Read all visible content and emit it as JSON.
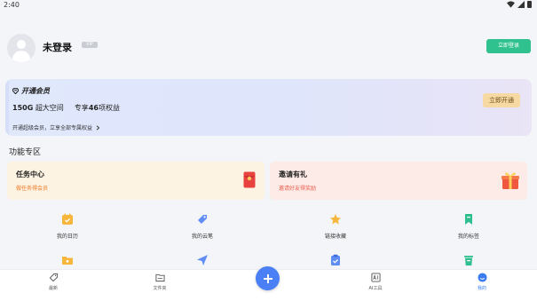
{
  "status_bar": {
    "time": "2:40"
  },
  "profile": {
    "name": "未登录",
    "vip_badge": "VIP",
    "signin_label": "立即登录"
  },
  "vip_card": {
    "title": "开通会员",
    "storage": "150G",
    "storage_suffix": "超大空间",
    "benefits_prefix": "专享",
    "benefits_count": "46",
    "benefits_suffix": "项权益",
    "promo": "开通超级会员，立享全部专属权益",
    "open_label": "立即开通"
  },
  "section_title": "功能专区",
  "cards": {
    "task": {
      "title": "任务中心",
      "subtitle": "做任务得会员"
    },
    "invite": {
      "title": "邀请有礼",
      "subtitle": "邀请好友得奖励"
    }
  },
  "tools": {
    "calendar": "我的日历",
    "cloud_notes": "我的云笔",
    "link_favorites": "链接收藏",
    "tags": "我的标签"
  },
  "nav": {
    "recent": "最新",
    "folder": "文件夹",
    "ai_tools": "AI工具",
    "mine": "我的"
  },
  "colors": {
    "accent": "#4b7ff5",
    "signin_green": "#2fc28f",
    "vip_gold": "#f7d9a4",
    "orange": "#ee7a26",
    "red": "#ea5d4f"
  }
}
